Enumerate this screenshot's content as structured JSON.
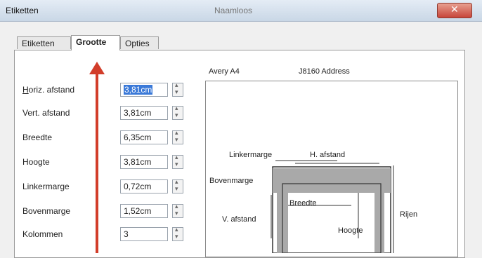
{
  "window": {
    "title": "Etiketten",
    "doc_title": "Naamloos",
    "close_glyph": "✕"
  },
  "tabs": [
    {
      "label": "Etiketten",
      "active": false
    },
    {
      "label": "Grootte",
      "active": true
    },
    {
      "label": "Opties",
      "active": false
    }
  ],
  "fields": [
    {
      "label": "Horiz. afstand",
      "mnemonic": "H",
      "value": "3,81cm",
      "selected": true
    },
    {
      "label": "Vert. afstand",
      "mnemonic": "V",
      "value": "3,81cm"
    },
    {
      "label": "Breedte",
      "mnemonic": "B",
      "value": "6,35cm"
    },
    {
      "label": "Hoogte",
      "mnemonic": "H",
      "value": "3,81cm"
    },
    {
      "label": "Linkermarge",
      "mnemonic": "m",
      "value": "0,72cm"
    },
    {
      "label": "Bovenmarge",
      "mnemonic": "B",
      "value": "1,52cm"
    },
    {
      "label": "Kolommen",
      "mnemonic": "K",
      "value": "3"
    }
  ],
  "preview": {
    "brand": "Avery A4",
    "product": "J8160 Address",
    "labels": {
      "left_margin": "Linkermarge",
      "h_spacing": "H. afstand",
      "top_margin": "Bovenmarge",
      "v_spacing": "V. afstand",
      "width": "Breedte",
      "height": "Hoogte",
      "rows": "Rijen"
    }
  },
  "colors": {
    "arrow": "#d23d2a",
    "selection": "#3a79d8",
    "label_fill": "#a9a9a9"
  }
}
